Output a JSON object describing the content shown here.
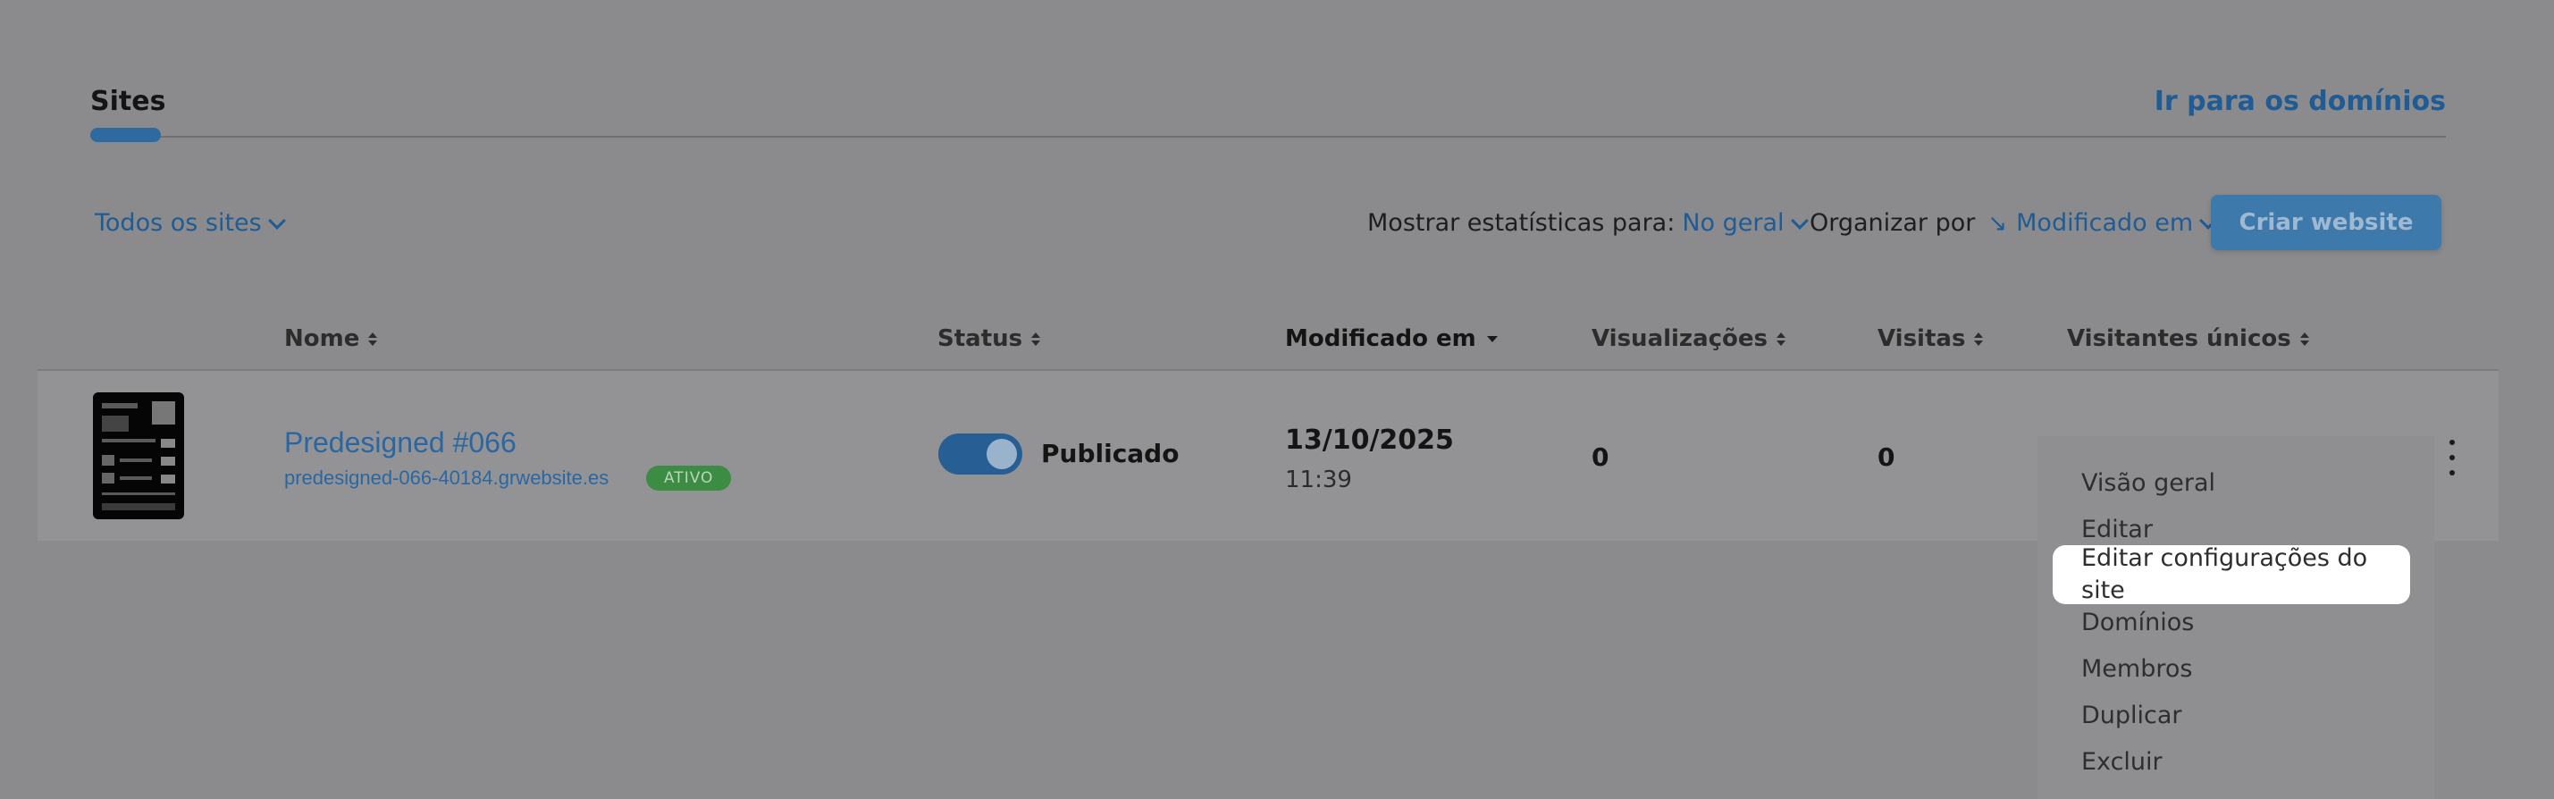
{
  "tabs": {
    "sites": "Sites",
    "goto_domains": "Ir para os domínios"
  },
  "toolbar": {
    "all_sites": "Todos os sites",
    "stats_label": "Mostrar estatísticas para:",
    "stats_value": "No geral",
    "sort_label": "Organizar por",
    "sort_arrow": "↘",
    "sort_value": "Modificado em",
    "create_button": "Criar website"
  },
  "table": {
    "headers": {
      "name": "Nome",
      "status": "Status",
      "modified": "Modificado em",
      "views": "Visualizações",
      "visits": "Visitas",
      "unique": "Visitantes únicos"
    },
    "rows": [
      {
        "name": "Predesigned #066",
        "url": "predesigned-066-40184.grwebsite.es",
        "badge": "ATIVO",
        "status": "Publicado",
        "date": "13/10/2025",
        "time": "11:39",
        "views": "0",
        "visits": "0"
      }
    ]
  },
  "menu": {
    "items": [
      "Visão geral",
      "Editar",
      "Editar configurações do site",
      "Domínios",
      "Membros",
      "Duplicar",
      "Excluir"
    ],
    "highlighted_index": 2
  },
  "colors": {
    "overlay_bg": "#8b8b8d",
    "link": "#1f5b94",
    "button": "#3e79ac",
    "badge": "#3c8c43"
  }
}
